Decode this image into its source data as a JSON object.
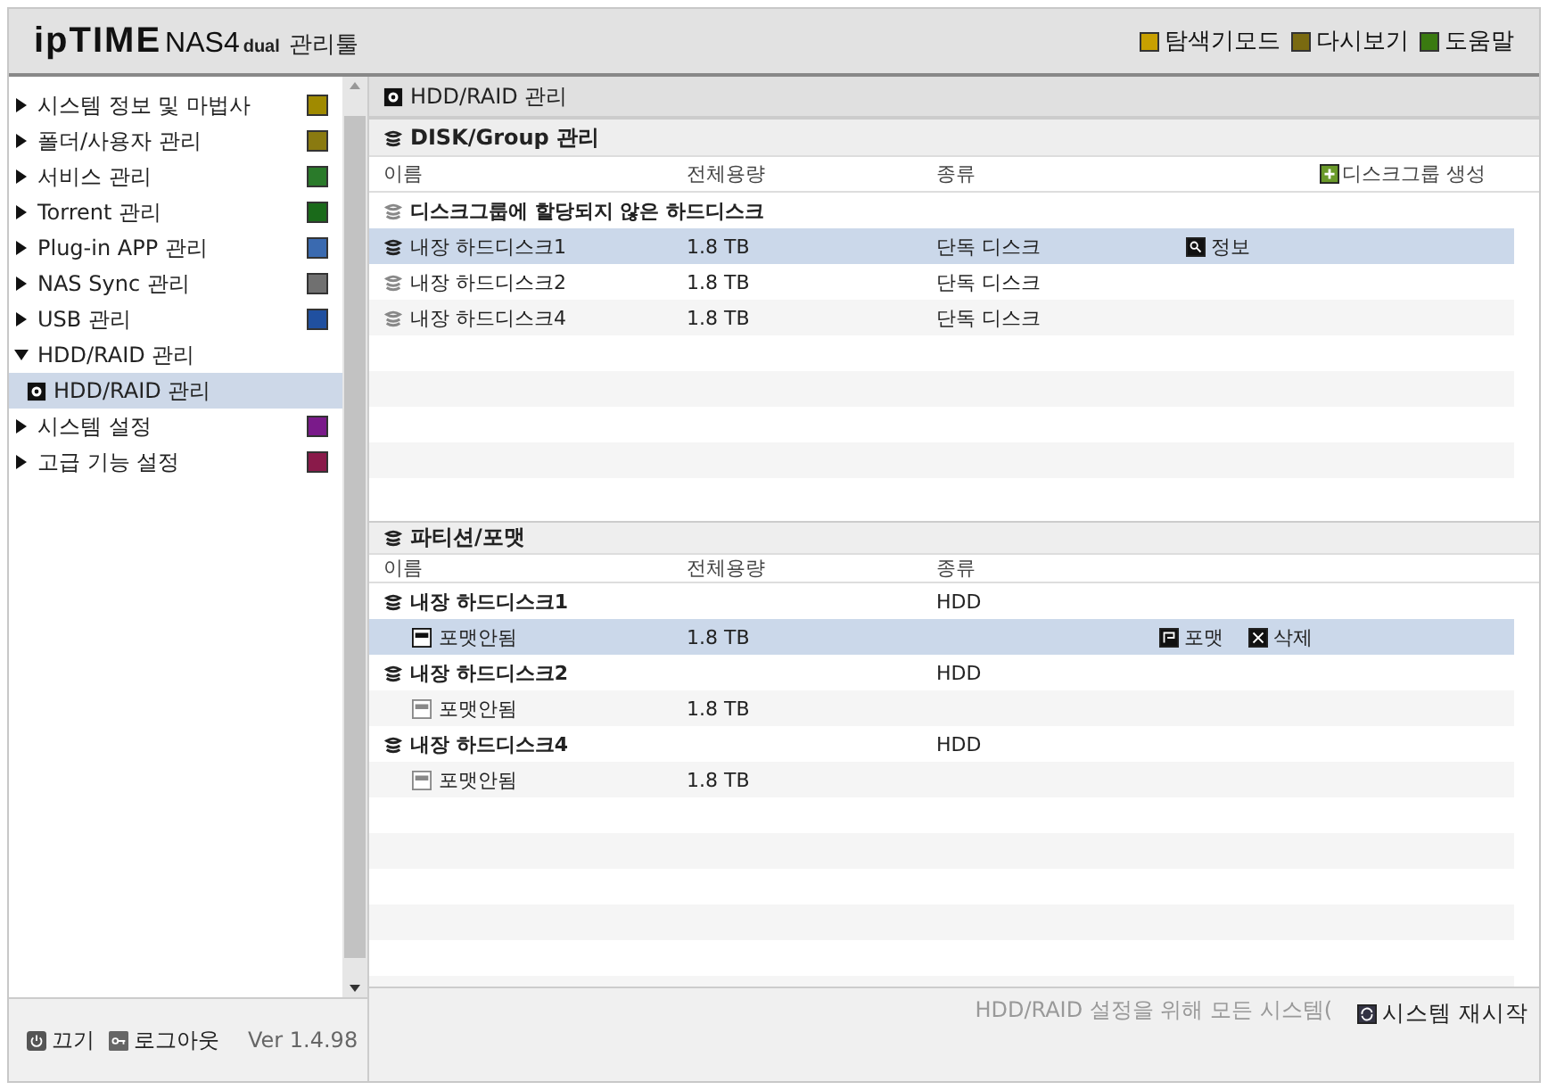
{
  "header": {
    "logo_brand": "ipTIME",
    "logo_model": "NAS4",
    "logo_suffix": "dual",
    "logo_tool": "관리툴",
    "links": [
      {
        "label": "탐색기모드",
        "color": "#c8a000"
      },
      {
        "label": "다시보기",
        "color": "#7a6a10"
      },
      {
        "label": "도움말",
        "color": "#3a7a10"
      }
    ]
  },
  "sidebar": {
    "items": [
      {
        "label": "시스템 정보 및 마법사",
        "expanded": false,
        "color": "#a08a00"
      },
      {
        "label": "폴더/사용자 관리",
        "expanded": false,
        "color": "#8a7a10"
      },
      {
        "label": "서비스 관리",
        "expanded": false,
        "color": "#2a7a2a"
      },
      {
        "label": "Torrent 관리",
        "expanded": false,
        "color": "#1a6a1a"
      },
      {
        "label": "Plug-in APP 관리",
        "expanded": false,
        "color": "#3a6ab0"
      },
      {
        "label": "NAS Sync 관리",
        "expanded": false,
        "color": "#707070"
      },
      {
        "label": "USB 관리",
        "expanded": false,
        "color": "#2050a0"
      },
      {
        "label": "HDD/RAID 관리",
        "expanded": true,
        "children": [
          {
            "label": "HDD/RAID 관리",
            "selected": true
          }
        ]
      },
      {
        "label": "시스템 설정",
        "expanded": false,
        "color": "#7a1a8a"
      },
      {
        "label": "고급 기능 설정",
        "expanded": false,
        "color": "#8a1a4a"
      }
    ]
  },
  "footer_left": {
    "power": "끄기",
    "logout": "로그아웃",
    "version": "Ver 1.4.98"
  },
  "main": {
    "title": "HDD/RAID 관리",
    "disk_group": {
      "title": "DISK/Group 관리",
      "columns": [
        "이름",
        "전체용량",
        "종류"
      ],
      "create_button": "디스크그룹 생성",
      "group_label": "디스크그룹에 할당되지 않은 하드디스크",
      "rows": [
        {
          "name": "내장 하드디스크1",
          "size": "1.8 TB",
          "type": "단독 디스크",
          "selected": true,
          "action": "정보"
        },
        {
          "name": "내장 하드디스크2",
          "size": "1.8 TB",
          "type": "단독 디스크",
          "selected": false
        },
        {
          "name": "내장 하드디스크4",
          "size": "1.8 TB",
          "type": "단독 디스크",
          "selected": false
        }
      ]
    },
    "partition": {
      "title": "파티션/포맷",
      "columns": [
        "이름",
        "전체용량",
        "종류"
      ],
      "rows": [
        {
          "kind": "disk",
          "name": "내장 하드디스크1",
          "type": "HDD",
          "selected": false
        },
        {
          "kind": "partition",
          "name": "포맷안됨",
          "size": "1.8 TB",
          "selected": true,
          "actions": [
            "포맷",
            "삭제"
          ]
        },
        {
          "kind": "disk",
          "name": "내장 하드디스크2",
          "type": "HDD",
          "selected": false
        },
        {
          "kind": "partition",
          "name": "포맷안됨",
          "size": "1.8 TB",
          "selected": false
        },
        {
          "kind": "disk",
          "name": "내장 하드디스크4",
          "type": "HDD",
          "selected": false
        },
        {
          "kind": "partition",
          "name": "포맷안됨",
          "size": "1.8 TB",
          "selected": false
        }
      ]
    },
    "status_text": "HDD/RAID 설정을 위해 모든 시스템(",
    "restart_button": "시스템 재시작"
  }
}
